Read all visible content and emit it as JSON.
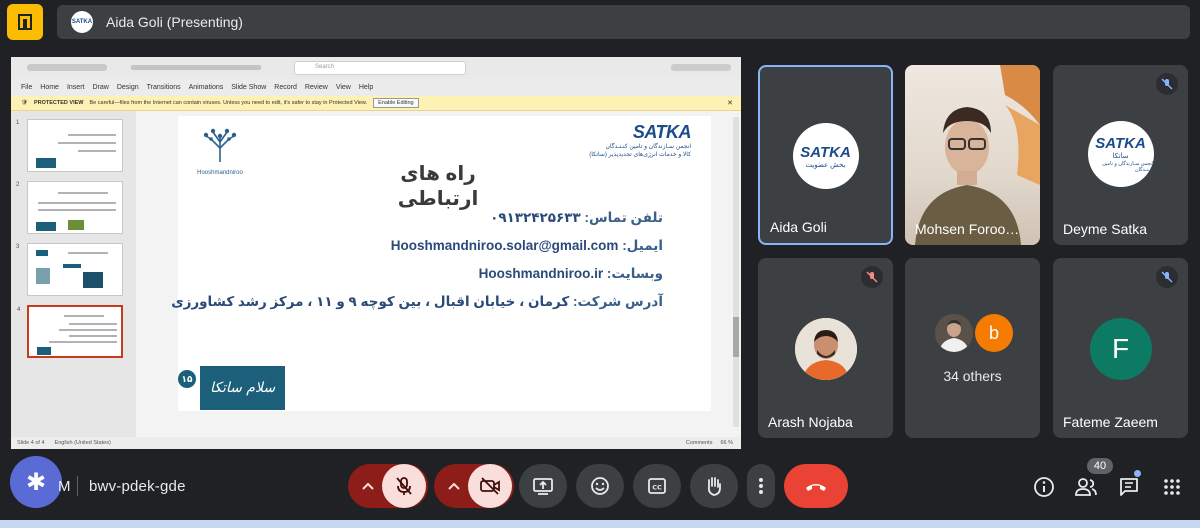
{
  "presenter_bar": {
    "label": "Aida Goli (Presenting)",
    "avatar_text": "SATKA"
  },
  "ppt": {
    "menu": [
      "File",
      "Home",
      "Insert",
      "Draw",
      "Design",
      "Transitions",
      "Animations",
      "Slide Show",
      "Record",
      "Review",
      "View",
      "Help"
    ],
    "search_placeholder": "Search",
    "protected_title": "PROTECTED VIEW",
    "protected_message": "Be careful—files from the Internet can contain viruses. Unless you need to edit, it's safer to stay in Protected View.",
    "enable_button": "Enable Editing",
    "thumb_numbers": [
      "1",
      "2",
      "3",
      "4"
    ],
    "status_left": "Slide 4 of 4",
    "status_lang": "English (United States)",
    "status_comments": "Comments",
    "zoom": "66 %"
  },
  "slide": {
    "left_logo_caption": "Hooshmandniroo",
    "satka_word": "SATKA",
    "satka_line1": "انجمن سـازندگان و تامین کنـنـدگان",
    "satka_line2": "کالا و خدمات انرژی‌های تجدیدپذیر (ساتکا)",
    "title": "راه های ارتباطی",
    "phone_label": "تلفن تماس:",
    "phone_value": "۰۹۱۳۲۴۲۵۶۳۳",
    "email_label": "ایمیل:",
    "email_value": "Hooshmandniroo.solar@gmail.com",
    "website_label": "وبسایت:",
    "website_value": "Hooshmandniroo.ir",
    "address_label": "آدرس شرکت:",
    "address_value": "کرمان ، خیابان اقبال ، بین کوچه ۹ و ۱۱ ، مرکز رشد کشاورزی",
    "page_badge": "۱۵",
    "salam_text": "سلام ساتکا"
  },
  "participants": [
    {
      "name": "Aida Goli",
      "kind": "satka-logo",
      "sub": "بخش عضویت"
    },
    {
      "name": "Mohsen Foroo…",
      "kind": "camera"
    },
    {
      "name": "Deyme Satka",
      "kind": "satka-logo",
      "sub": "ساتکا"
    },
    {
      "name": "Arash Nojaba",
      "kind": "photo"
    },
    {
      "name": "34 others",
      "kind": "others",
      "letter": "b"
    },
    {
      "name": "Fateme Zaeem",
      "kind": "letter",
      "letter": "F"
    }
  ],
  "bottom": {
    "time_tail": "M",
    "meeting_code": "bwv-pdek-gde",
    "people_count": "40"
  },
  "colors": {
    "background": "#202124",
    "tile": "#3c4043",
    "accent_blue": "#8ab4f8",
    "hangup": "#ea4335",
    "muted_group": "#8c1d18",
    "muted_button": "#f9dedc",
    "present_icon": "#fbbc04"
  },
  "icons": [
    "app-panel-icon",
    "mic-off-icon",
    "camera-off-icon",
    "present-screen-icon",
    "emoji-icon",
    "captions-icon",
    "raise-hand-icon",
    "more-vert-icon",
    "call-end-icon",
    "info-icon",
    "people-icon",
    "chat-icon",
    "apps-grid-icon",
    "assistant-icon"
  ]
}
